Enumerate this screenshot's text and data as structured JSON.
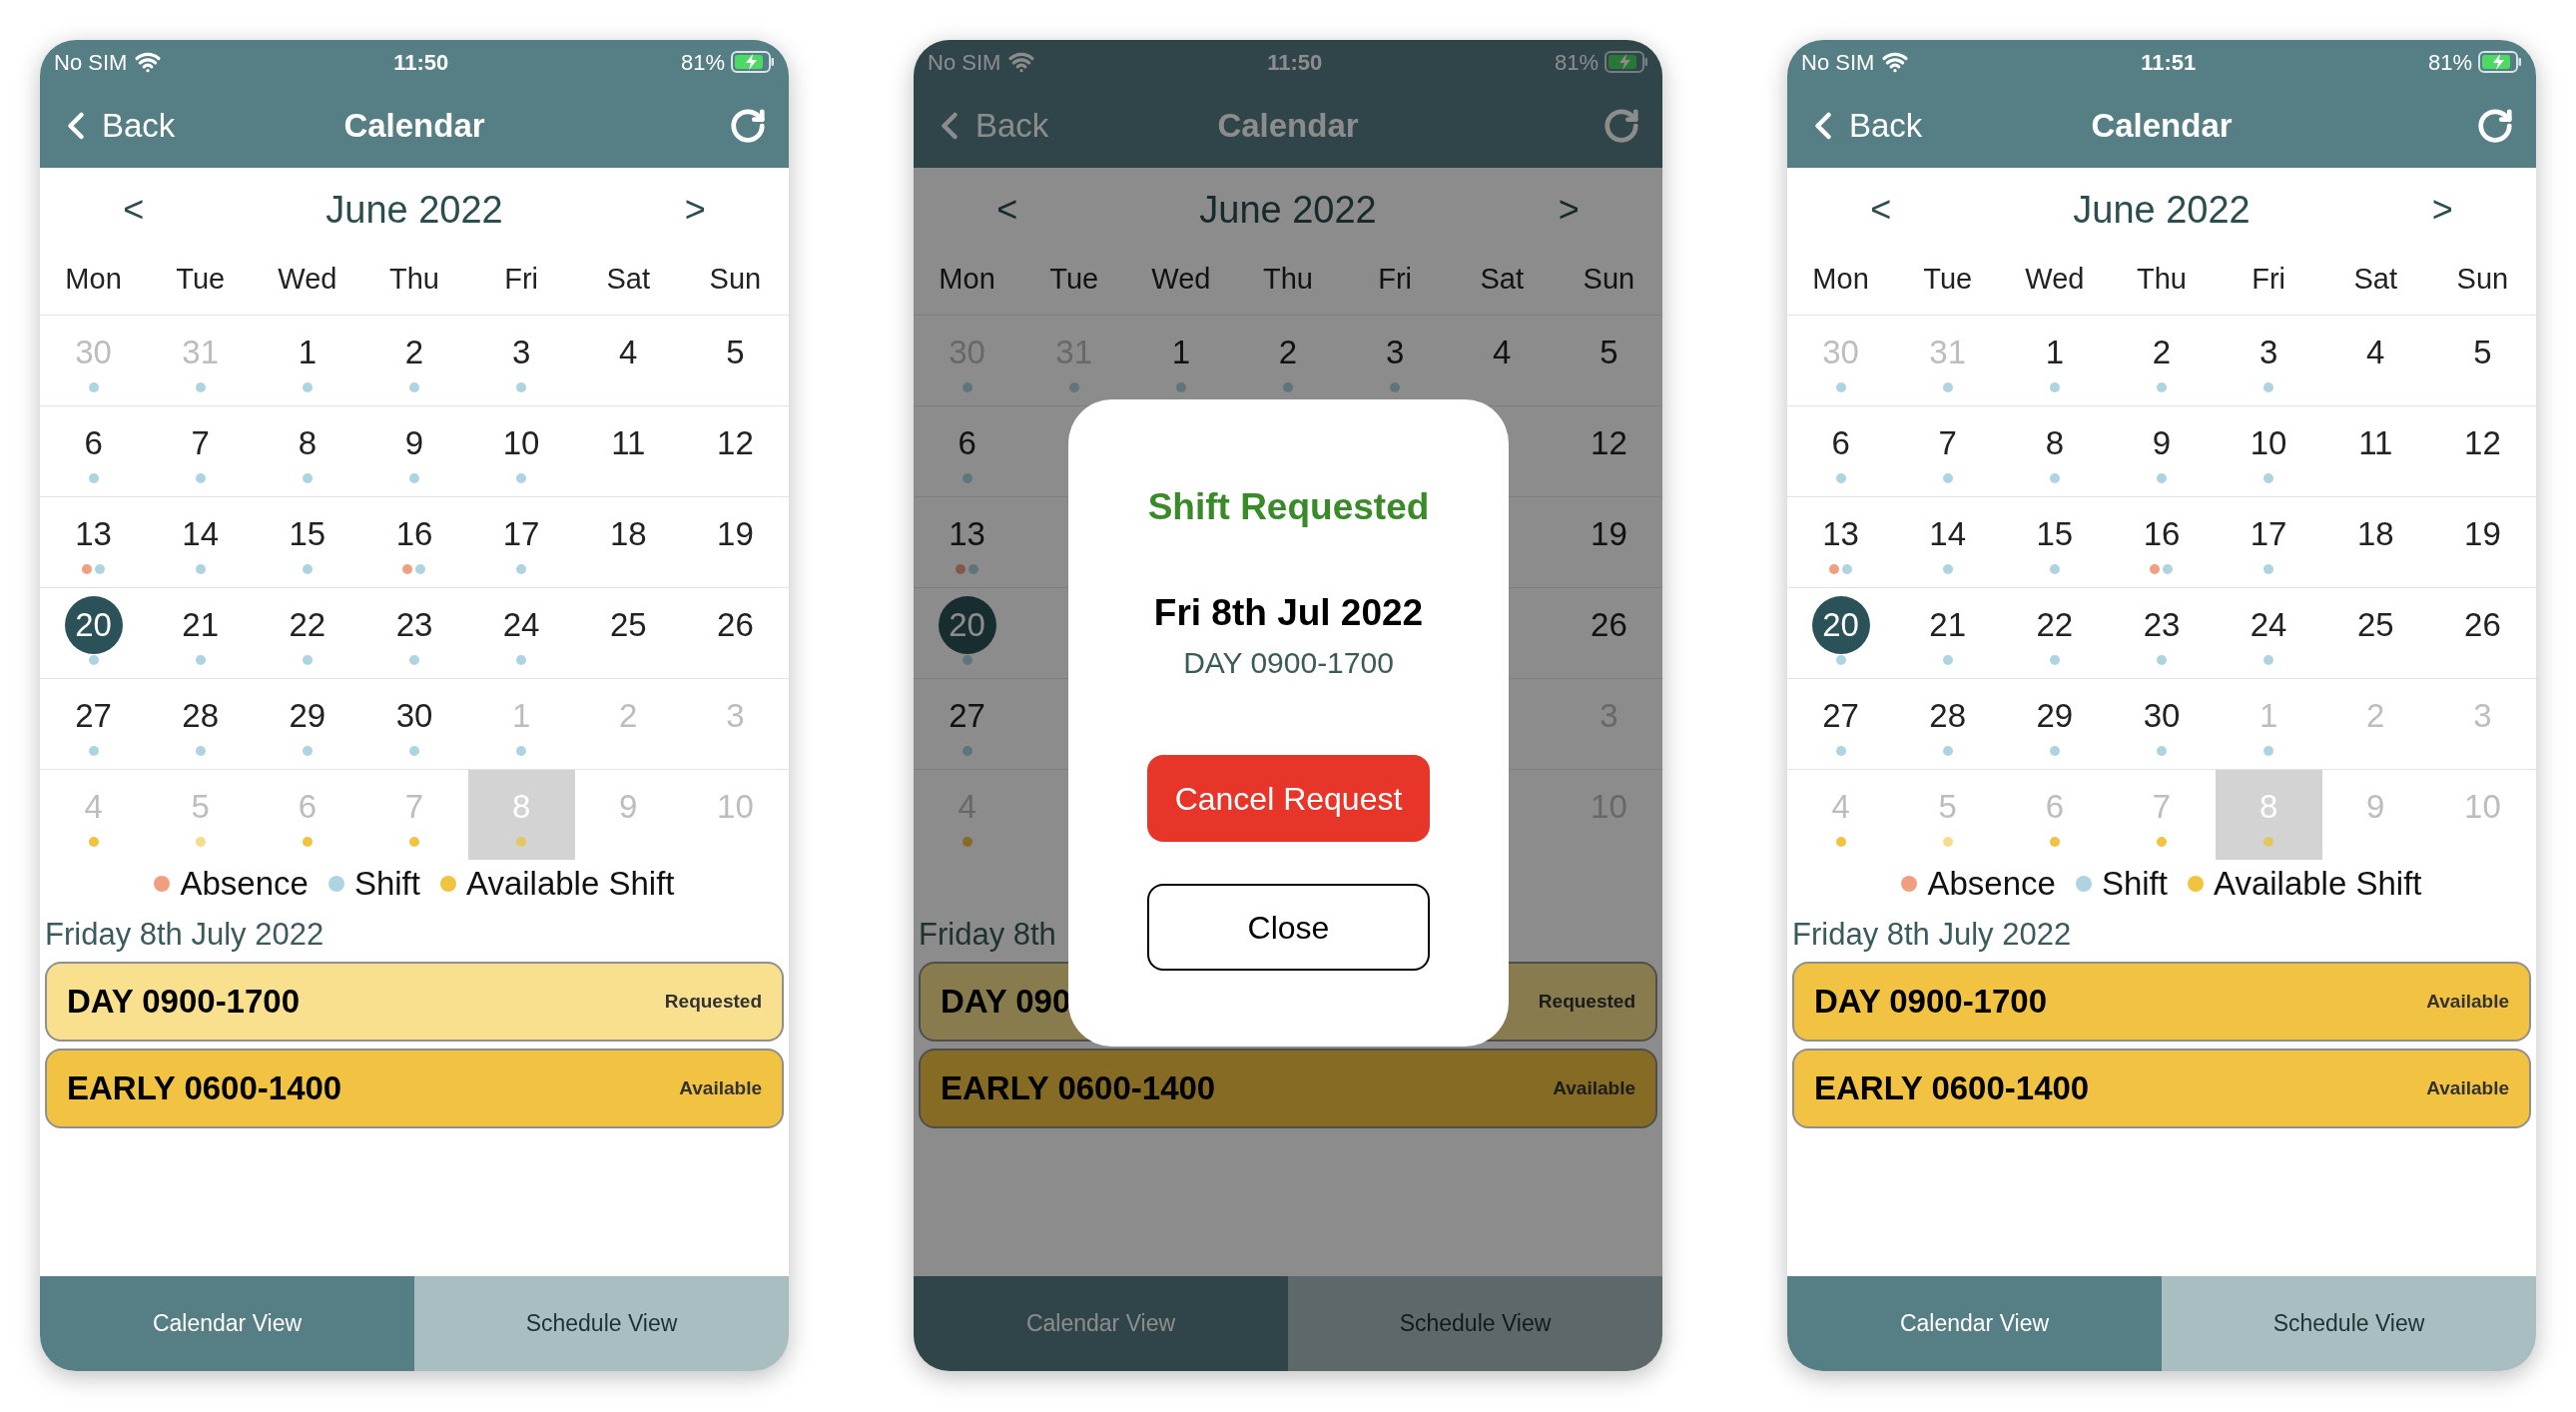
{
  "phones": [
    {
      "status": {
        "carrier": "No SIM",
        "time": "11:50",
        "battery": "81%"
      },
      "nav": {
        "back": "Back",
        "title": "Calendar"
      },
      "calendar": {
        "prev": "<",
        "month": "June 2022",
        "next": ">",
        "weekdays": [
          "Mon",
          "Tue",
          "Wed",
          "Thu",
          "Fri",
          "Sat",
          "Sun"
        ],
        "weeks": [
          [
            {
              "day": "30",
              "muted": true,
              "today": false,
              "selected": false,
              "dots": [
                {
                  "color": "#add4e0"
                }
              ]
            },
            {
              "day": "31",
              "muted": true,
              "today": false,
              "selected": false,
              "dots": [
                {
                  "color": "#add4e0"
                }
              ]
            },
            {
              "day": "1",
              "muted": false,
              "today": false,
              "selected": false,
              "dots": [
                {
                  "color": "#add4e0"
                }
              ]
            },
            {
              "day": "2",
              "muted": false,
              "today": false,
              "selected": false,
              "dots": [
                {
                  "color": "#add4e0"
                }
              ]
            },
            {
              "day": "3",
              "muted": false,
              "today": false,
              "selected": false,
              "dots": [
                {
                  "color": "#add4e0"
                }
              ]
            },
            {
              "day": "4",
              "muted": false,
              "today": false,
              "selected": false
            },
            {
              "day": "5",
              "muted": false,
              "today": false,
              "selected": false
            }
          ],
          [
            {
              "day": "6",
              "muted": false,
              "today": false,
              "selected": false,
              "dots": [
                {
                  "color": "#add4e0"
                }
              ]
            },
            {
              "day": "7",
              "muted": false,
              "today": false,
              "selected": false,
              "dots": [
                {
                  "color": "#add4e0"
                }
              ]
            },
            {
              "day": "8",
              "muted": false,
              "today": false,
              "selected": false,
              "dots": [
                {
                  "color": "#add4e0"
                }
              ]
            },
            {
              "day": "9",
              "muted": false,
              "today": false,
              "selected": false,
              "dots": [
                {
                  "color": "#add4e0"
                }
              ]
            },
            {
              "day": "10",
              "muted": false,
              "today": false,
              "selected": false,
              "dots": [
                {
                  "color": "#add4e0"
                }
              ]
            },
            {
              "day": "11",
              "muted": false,
              "today": false,
              "selected": false
            },
            {
              "day": "12",
              "muted": false,
              "today": false,
              "selected": false
            }
          ],
          [
            {
              "day": "13",
              "muted": false,
              "today": false,
              "selected": false,
              "dots": [
                {
                  "color": "#f0a080"
                },
                {
                  "color": "#add4e0"
                }
              ]
            },
            {
              "day": "14",
              "muted": false,
              "today": false,
              "selected": false,
              "dots": [
                {
                  "color": "#add4e0"
                }
              ]
            },
            {
              "day": "15",
              "muted": false,
              "today": false,
              "selected": false,
              "dots": [
                {
                  "color": "#add4e0"
                }
              ]
            },
            {
              "day": "16",
              "muted": false,
              "today": false,
              "selected": false,
              "dots": [
                {
                  "color": "#f0a080"
                },
                {
                  "color": "#add4e0"
                }
              ]
            },
            {
              "day": "17",
              "muted": false,
              "today": false,
              "selected": false,
              "dots": [
                {
                  "color": "#add4e0"
                }
              ]
            },
            {
              "day": "18",
              "muted": false,
              "today": false,
              "selected": false
            },
            {
              "day": "19",
              "muted": false,
              "today": false,
              "selected": false
            }
          ],
          [
            {
              "day": "20",
              "muted": false,
              "today": true,
              "selected": false,
              "dots": [
                {
                  "color": "#add4e0"
                }
              ]
            },
            {
              "day": "21",
              "muted": false,
              "today": false,
              "selected": false,
              "dots": [
                {
                  "color": "#add4e0"
                }
              ]
            },
            {
              "day": "22",
              "muted": false,
              "today": false,
              "selected": false,
              "dots": [
                {
                  "color": "#add4e0"
                }
              ]
            },
            {
              "day": "23",
              "muted": false,
              "today": false,
              "selected": false,
              "dots": [
                {
                  "color": "#add4e0"
                }
              ]
            },
            {
              "day": "24",
              "muted": false,
              "today": false,
              "selected": false,
              "dots": [
                {
                  "color": "#add4e0"
                }
              ]
            },
            {
              "day": "25",
              "muted": false,
              "today": false,
              "selected": false
            },
            {
              "day": "26",
              "muted": false,
              "today": false,
              "selected": false
            }
          ],
          [
            {
              "day": "27",
              "muted": false,
              "today": false,
              "selected": false,
              "dots": [
                {
                  "color": "#add4e0"
                }
              ]
            },
            {
              "day": "28",
              "muted": false,
              "today": false,
              "selected": false,
              "dots": [
                {
                  "color": "#add4e0"
                }
              ]
            },
            {
              "day": "29",
              "muted": false,
              "today": false,
              "selected": false,
              "dots": [
                {
                  "color": "#add4e0"
                }
              ]
            },
            {
              "day": "30",
              "muted": false,
              "today": false,
              "selected": false,
              "dots": [
                {
                  "color": "#add4e0"
                }
              ]
            },
            {
              "day": "1",
              "muted": true,
              "today": false,
              "selected": false,
              "dots": [
                {
                  "color": "#add4e0"
                }
              ]
            },
            {
              "day": "2",
              "muted": true,
              "today": false,
              "selected": false
            },
            {
              "day": "3",
              "muted": true,
              "today": false,
              "selected": false
            }
          ],
          [
            {
              "day": "4",
              "muted": true,
              "today": false,
              "selected": false,
              "dots": [
                {
                  "color": "#f2c341"
                }
              ]
            },
            {
              "day": "5",
              "muted": true,
              "today": false,
              "selected": false,
              "dots": [
                {
                  "color": "#f6dc8c"
                }
              ]
            },
            {
              "day": "6",
              "muted": true,
              "today": false,
              "selected": false,
              "dots": [
                {
                  "color": "#f2c341"
                }
              ]
            },
            {
              "day": "7",
              "muted": true,
              "today": false,
              "selected": false,
              "dots": [
                {
                  "color": "#f2c341"
                }
              ]
            },
            {
              "day": "8",
              "muted": true,
              "today": false,
              "selected": true,
              "dots": [
                {
                  "color": "#e6c65e"
                }
              ]
            },
            {
              "day": "9",
              "muted": true,
              "today": false,
              "selected": false
            },
            {
              "day": "10",
              "muted": true,
              "today": false,
              "selected": false
            }
          ]
        ]
      },
      "legend": [
        {
          "label": "Absence",
          "color": "#f0a080"
        },
        {
          "label": "Shift",
          "color": "#add4e0"
        },
        {
          "label": "Available Shift",
          "color": "#f2c341"
        }
      ],
      "date_label": "Friday 8th July 2022",
      "events": [
        {
          "title": "DAY 0900-1700",
          "status": "Requested",
          "kind": "requested"
        },
        {
          "title": "EARLY 0600-1400",
          "status": "Available",
          "kind": "available"
        }
      ],
      "tabs": [
        {
          "label": "Calendar View",
          "selected": true
        },
        {
          "label": "Schedule View",
          "selected": false
        }
      ]
    },
    {
      "status": {
        "carrier": "No SIM",
        "time": "11:50",
        "battery": "81%"
      },
      "nav": {
        "back": "Back",
        "title": "Calendar"
      },
      "calendar": {
        "prev": "<",
        "month": "June 2022",
        "next": ">",
        "weekdays": [
          "Mon",
          "Tue",
          "Wed",
          "Thu",
          "Fri",
          "Sat",
          "Sun"
        ],
        "weeks": [
          [
            {
              "day": "30",
              "muted": true,
              "today": false,
              "selected": false,
              "dots": [
                {
                  "color": "#5f757b"
                }
              ]
            },
            {
              "day": "31",
              "muted": true,
              "today": false,
              "selected": false,
              "dots": [
                {
                  "color": "#5f757b"
                }
              ]
            },
            {
              "day": "1",
              "muted": false,
              "today": false,
              "selected": false,
              "dots": [
                {
                  "color": "#5f757b"
                }
              ]
            },
            {
              "day": "2",
              "muted": false,
              "today": false,
              "selected": false,
              "dots": [
                {
                  "color": "#5f757b"
                }
              ]
            },
            {
              "day": "3",
              "muted": false,
              "today": false,
              "selected": false,
              "dots": [
                {
                  "color": "#5f757b"
                }
              ]
            },
            {
              "day": "4",
              "muted": false,
              "today": false,
              "selected": false
            },
            {
              "day": "5",
              "muted": false,
              "today": false,
              "selected": false
            }
          ],
          {
            "first": {
              "day": "6",
              "muted": false,
              "today": false,
              "selected": false,
              "dots": [
                {
                  "color": "#5f757b"
                }
              ]
            },
            "last": {
              "day": "12",
              "muted": false,
              "today": false,
              "selected": false
            }
          },
          {
            "first": {
              "day": "13",
              "muted": false,
              "today": false,
              "selected": false,
              "dots": [
                {
                  "color": "#845846"
                },
                {
                  "color": "#5f757b"
                }
              ]
            },
            "last": {
              "day": "19",
              "muted": false,
              "today": false,
              "selected": false
            }
          },
          {
            "first": {
              "day": "20",
              "muted": false,
              "today": true,
              "selected": false,
              "dots": [
                {
                  "color": "#5f757b"
                }
              ]
            },
            "last": {
              "day": "26",
              "muted": false,
              "today": false,
              "selected": false
            }
          },
          {
            "first": {
              "day": "27",
              "muted": false,
              "today": false,
              "selected": false,
              "dots": [
                {
                  "color": "#5f757b"
                }
              ]
            },
            "last": {
              "day": "3",
              "muted": true,
              "today": false,
              "selected": false
            }
          },
          {
            "first": {
              "day": "4",
              "muted": true,
              "today": false,
              "selected": false,
              "dots": [
                {
                  "color": "#856b24"
                }
              ]
            },
            "last": {
              "day": "10",
              "muted": true,
              "today": false,
              "selected": false
            }
          }
        ]
      },
      "date_label": "Friday 8th",
      "events": [
        {
          "title": "DAY 090",
          "status": "Requested",
          "kind": "requested"
        },
        {
          "title": "EARLY 0600-1400",
          "status": "Available",
          "kind": "available"
        }
      ],
      "tabs": [
        {
          "label": "Calendar View",
          "selected": true
        },
        {
          "label": "Schedule View",
          "selected": false
        }
      ],
      "modal": {
        "title": "Shift Requested",
        "date": "Fri 8th Jul 2022",
        "shift": "DAY 0900-1700",
        "primary_button": "Cancel Request",
        "secondary_button": "Close"
      }
    },
    {
      "status": {
        "carrier": "No SIM",
        "time": "11:51",
        "battery": "81%"
      },
      "nav": {
        "back": "Back",
        "title": "Calendar"
      },
      "calendar": {
        "prev": "<",
        "month": "June 2022",
        "next": ">",
        "weekdays": [
          "Mon",
          "Tue",
          "Wed",
          "Thu",
          "Fri",
          "Sat",
          "Sun"
        ],
        "weeks": [
          [
            {
              "day": "30",
              "muted": true,
              "today": false,
              "selected": false,
              "dots": [
                {
                  "color": "#add4e0"
                }
              ]
            },
            {
              "day": "31",
              "muted": true,
              "today": false,
              "selected": false,
              "dots": [
                {
                  "color": "#add4e0"
                }
              ]
            },
            {
              "day": "1",
              "muted": false,
              "today": false,
              "selected": false,
              "dots": [
                {
                  "color": "#add4e0"
                }
              ]
            },
            {
              "day": "2",
              "muted": false,
              "today": false,
              "selected": false,
              "dots": [
                {
                  "color": "#add4e0"
                }
              ]
            },
            {
              "day": "3",
              "muted": false,
              "today": false,
              "selected": false,
              "dots": [
                {
                  "color": "#add4e0"
                }
              ]
            },
            {
              "day": "4",
              "muted": false,
              "today": false,
              "selected": false
            },
            {
              "day": "5",
              "muted": false,
              "today": false,
              "selected": false
            }
          ],
          [
            {
              "day": "6",
              "muted": false,
              "today": false,
              "selected": false,
              "dots": [
                {
                  "color": "#add4e0"
                }
              ]
            },
            {
              "day": "7",
              "muted": false,
              "today": false,
              "selected": false,
              "dots": [
                {
                  "color": "#add4e0"
                }
              ]
            },
            {
              "day": "8",
              "muted": false,
              "today": false,
              "selected": false,
              "dots": [
                {
                  "color": "#add4e0"
                }
              ]
            },
            {
              "day": "9",
              "muted": false,
              "today": false,
              "selected": false,
              "dots": [
                {
                  "color": "#add4e0"
                }
              ]
            },
            {
              "day": "10",
              "muted": false,
              "today": false,
              "selected": false,
              "dots": [
                {
                  "color": "#add4e0"
                }
              ]
            },
            {
              "day": "11",
              "muted": false,
              "today": false,
              "selected": false
            },
            {
              "day": "12",
              "muted": false,
              "today": false,
              "selected": false
            }
          ],
          [
            {
              "day": "13",
              "muted": false,
              "today": false,
              "selected": false,
              "dots": [
                {
                  "color": "#f0a080"
                },
                {
                  "color": "#add4e0"
                }
              ]
            },
            {
              "day": "14",
              "muted": false,
              "today": false,
              "selected": false,
              "dots": [
                {
                  "color": "#add4e0"
                }
              ]
            },
            {
              "day": "15",
              "muted": false,
              "today": false,
              "selected": false,
              "dots": [
                {
                  "color": "#add4e0"
                }
              ]
            },
            {
              "day": "16",
              "muted": false,
              "today": false,
              "selected": false,
              "dots": [
                {
                  "color": "#f0a080"
                },
                {
                  "color": "#add4e0"
                }
              ]
            },
            {
              "day": "17",
              "muted": false,
              "today": false,
              "selected": false,
              "dots": [
                {
                  "color": "#add4e0"
                }
              ]
            },
            {
              "day": "18",
              "muted": false,
              "today": false,
              "selected": false
            },
            {
              "day": "19",
              "muted": false,
              "today": false,
              "selected": false
            }
          ],
          [
            {
              "day": "20",
              "muted": false,
              "today": true,
              "selected": false,
              "dots": [
                {
                  "color": "#add4e0"
                }
              ]
            },
            {
              "day": "21",
              "muted": false,
              "today": false,
              "selected": false,
              "dots": [
                {
                  "color": "#add4e0"
                }
              ]
            },
            {
              "day": "22",
              "muted": false,
              "today": false,
              "selected": false,
              "dots": [
                {
                  "color": "#add4e0"
                }
              ]
            },
            {
              "day": "23",
              "muted": false,
              "today": false,
              "selected": false,
              "dots": [
                {
                  "color": "#add4e0"
                }
              ]
            },
            {
              "day": "24",
              "muted": false,
              "today": false,
              "selected": false,
              "dots": [
                {
                  "color": "#add4e0"
                }
              ]
            },
            {
              "day": "25",
              "muted": false,
              "today": false,
              "selected": false
            },
            {
              "day": "26",
              "muted": false,
              "today": false,
              "selected": false
            }
          ],
          [
            {
              "day": "27",
              "muted": false,
              "today": false,
              "selected": false,
              "dots": [
                {
                  "color": "#add4e0"
                }
              ]
            },
            {
              "day": "28",
              "muted": false,
              "today": false,
              "selected": false,
              "dots": [
                {
                  "color": "#add4e0"
                }
              ]
            },
            {
              "day": "29",
              "muted": false,
              "today": false,
              "selected": false,
              "dots": [
                {
                  "color": "#add4e0"
                }
              ]
            },
            {
              "day": "30",
              "muted": false,
              "today": false,
              "selected": false,
              "dots": [
                {
                  "color": "#add4e0"
                }
              ]
            },
            {
              "day": "1",
              "muted": true,
              "today": false,
              "selected": false,
              "dots": [
                {
                  "color": "#add4e0"
                }
              ]
            },
            {
              "day": "2",
              "muted": true,
              "today": false,
              "selected": false
            },
            {
              "day": "3",
              "muted": true,
              "today": false,
              "selected": false
            }
          ],
          [
            {
              "day": "4",
              "muted": true,
              "today": false,
              "selected": false,
              "dots": [
                {
                  "color": "#f2c341"
                }
              ]
            },
            {
              "day": "5",
              "muted": true,
              "today": false,
              "selected": false,
              "dots": [
                {
                  "color": "#f6dc8c"
                }
              ]
            },
            {
              "day": "6",
              "muted": true,
              "today": false,
              "selected": false,
              "dots": [
                {
                  "color": "#f2c341"
                }
              ]
            },
            {
              "day": "7",
              "muted": true,
              "today": false,
              "selected": false,
              "dots": [
                {
                  "color": "#f2c341"
                }
              ]
            },
            {
              "day": "8",
              "muted": true,
              "today": false,
              "selected": true,
              "dots": [
                {
                  "color": "#e6c65e"
                }
              ]
            },
            {
              "day": "9",
              "muted": true,
              "today": false,
              "selected": false
            },
            {
              "day": "10",
              "muted": true,
              "today": false,
              "selected": false
            }
          ]
        ]
      },
      "legend": [
        {
          "label": "Absence",
          "color": "#f0a080"
        },
        {
          "label": "Shift",
          "color": "#add4e0"
        },
        {
          "label": "Available Shift",
          "color": "#f2c341"
        }
      ],
      "date_label": "Friday 8th July 2022",
      "events": [
        {
          "title": "DAY 0900-1700",
          "status": "Available",
          "kind": "available"
        },
        {
          "title": "EARLY 0600-1400",
          "status": "Available",
          "kind": "available"
        }
      ],
      "tabs": [
        {
          "label": "Calendar View",
          "selected": true
        },
        {
          "label": "Schedule View",
          "selected": false
        }
      ]
    }
  ]
}
